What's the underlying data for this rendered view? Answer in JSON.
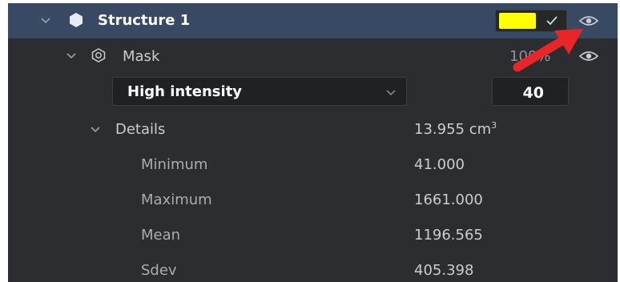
{
  "structure": {
    "name": "Structure 1",
    "color": "#ffff00"
  },
  "mask": {
    "name": "Mask",
    "opacity": "100%"
  },
  "controls": {
    "intensity_selected": "High intensity",
    "threshold_value": "40"
  },
  "details": {
    "label": "Details",
    "volume": "13.955 cm",
    "volume_unit_sup": "3"
  },
  "stats": [
    {
      "label": "Minimum",
      "value": "41.000"
    },
    {
      "label": "Maximum",
      "value": "1661.000"
    },
    {
      "label": "Mean",
      "value": "1196.565"
    },
    {
      "label": "Sdev",
      "value": "405.398"
    }
  ],
  "icons": {
    "expand": "chevron-down-icon",
    "structure": "hexagon-icon",
    "mask": "mask-icon",
    "visibility": "eye-icon",
    "confirm": "check-icon",
    "annotation": "red-arrow-icon"
  },
  "colors": {
    "panel_bg": "#2b2d31",
    "selected_row_bg": "#384a63",
    "annotation_arrow": "#e8262a"
  }
}
